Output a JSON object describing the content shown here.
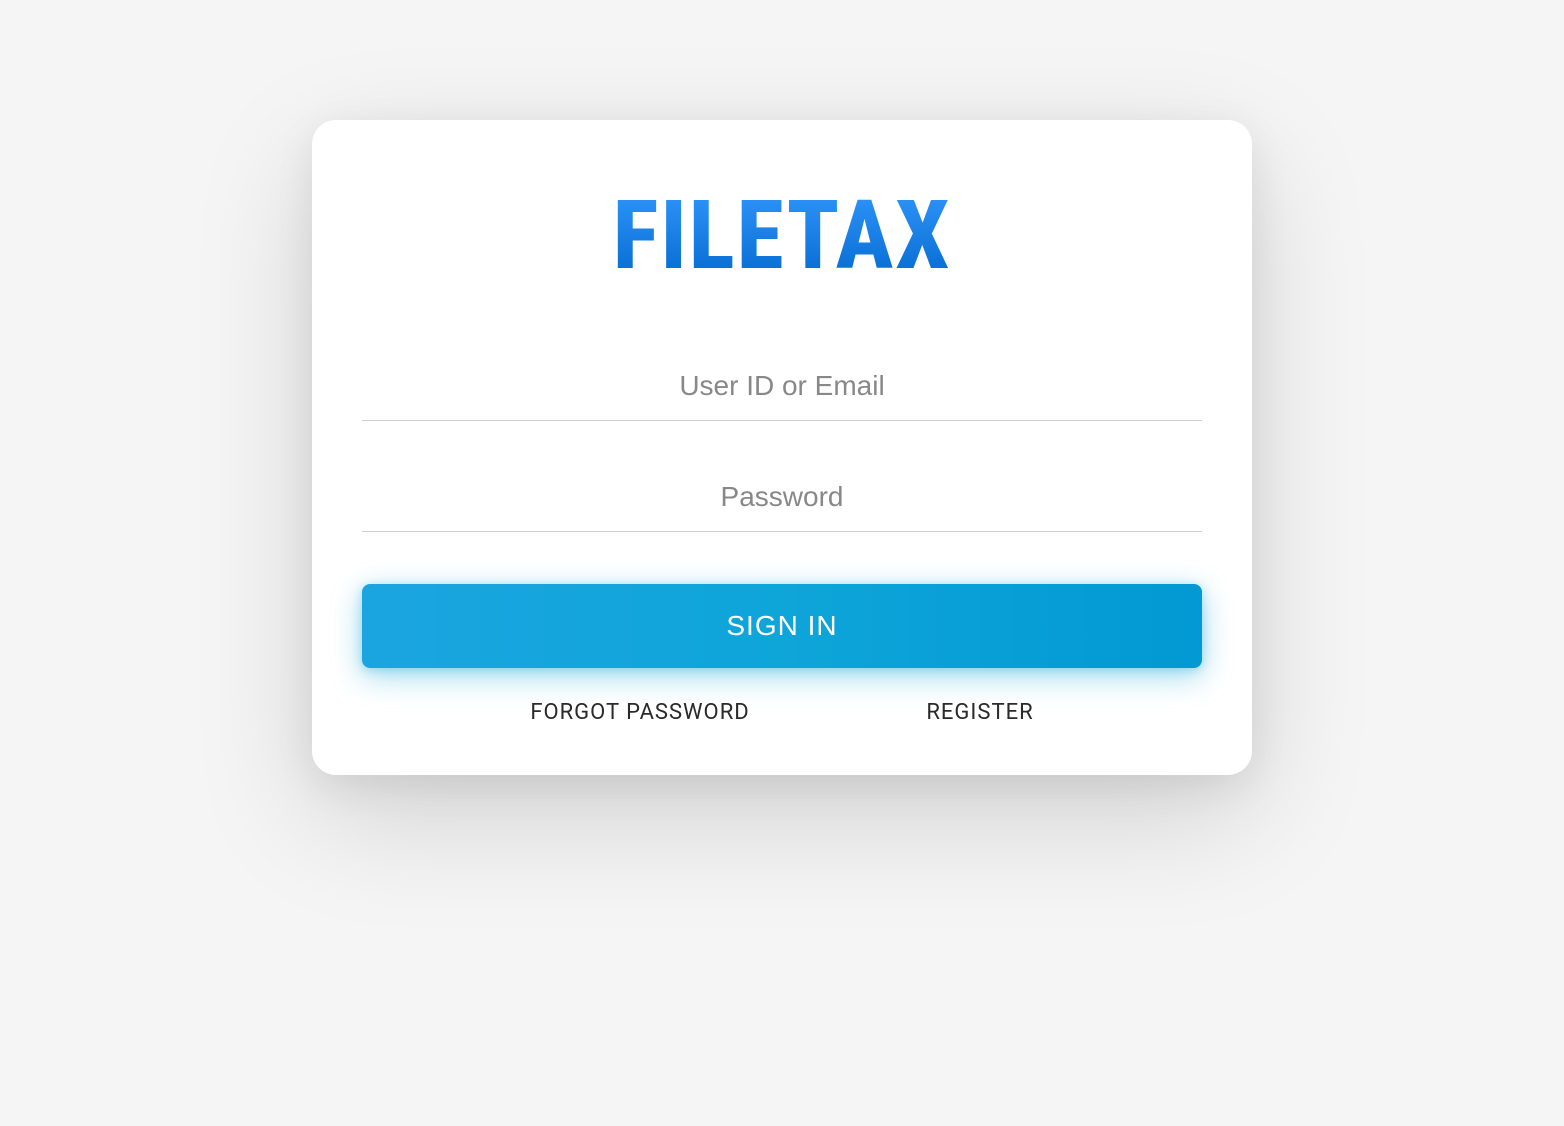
{
  "logo": {
    "text": "FILETAX"
  },
  "form": {
    "user_placeholder": "User ID or Email",
    "password_placeholder": "Password",
    "signin_label": "SIGN IN"
  },
  "links": {
    "forgot_password": "FORGOT PASSWORD",
    "register": "REGISTER"
  }
}
